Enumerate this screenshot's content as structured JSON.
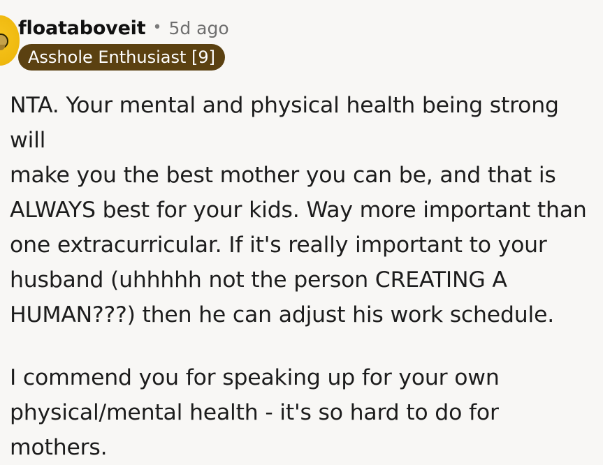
{
  "comment": {
    "author": "floataboveit",
    "separator": "•",
    "timestamp": "5d ago",
    "flair": "Asshole Enthusiast [9]",
    "paragraphs": [
      "NTA. Your mental and physical health being strong will\nmake you the best mother you can be, and that is\nALWAYS best for your kids. Way more important than\none extracurricular. If it's really important to your\nhusband (uhhhhh not the person CREATING A\nHUMAN???) then he can adjust his work schedule.",
      "I commend you for speaking up for your own\nphysical/mental health - it's so hard to do for\nmothers."
    ]
  },
  "colors": {
    "background": "#f8f7f5",
    "flair_bg": "#5b4111",
    "avatar": "#efb90f"
  },
  "icons": {
    "avatar": "snoo-avatar-icon"
  }
}
